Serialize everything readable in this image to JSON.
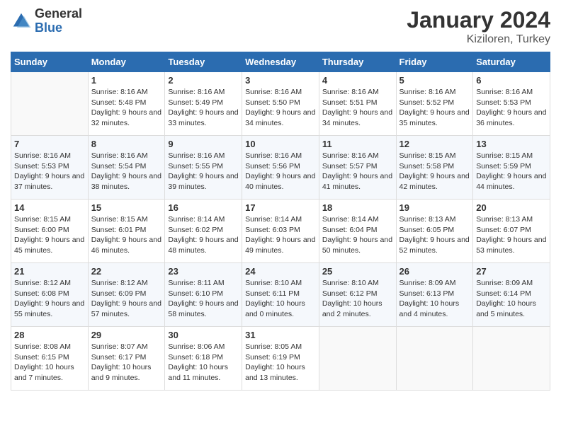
{
  "header": {
    "logo": {
      "general": "General",
      "blue": "Blue"
    },
    "title": "January 2024",
    "subtitle": "Kiziloren, Turkey"
  },
  "calendar": {
    "weekdays": [
      "Sunday",
      "Monday",
      "Tuesday",
      "Wednesday",
      "Thursday",
      "Friday",
      "Saturday"
    ],
    "weeks": [
      [
        {
          "day": "",
          "sunrise": "",
          "sunset": "",
          "daylight": ""
        },
        {
          "day": "1",
          "sunrise": "Sunrise: 8:16 AM",
          "sunset": "Sunset: 5:48 PM",
          "daylight": "Daylight: 9 hours and 32 minutes."
        },
        {
          "day": "2",
          "sunrise": "Sunrise: 8:16 AM",
          "sunset": "Sunset: 5:49 PM",
          "daylight": "Daylight: 9 hours and 33 minutes."
        },
        {
          "day": "3",
          "sunrise": "Sunrise: 8:16 AM",
          "sunset": "Sunset: 5:50 PM",
          "daylight": "Daylight: 9 hours and 34 minutes."
        },
        {
          "day": "4",
          "sunrise": "Sunrise: 8:16 AM",
          "sunset": "Sunset: 5:51 PM",
          "daylight": "Daylight: 9 hours and 34 minutes."
        },
        {
          "day": "5",
          "sunrise": "Sunrise: 8:16 AM",
          "sunset": "Sunset: 5:52 PM",
          "daylight": "Daylight: 9 hours and 35 minutes."
        },
        {
          "day": "6",
          "sunrise": "Sunrise: 8:16 AM",
          "sunset": "Sunset: 5:53 PM",
          "daylight": "Daylight: 9 hours and 36 minutes."
        }
      ],
      [
        {
          "day": "7",
          "sunrise": "Sunrise: 8:16 AM",
          "sunset": "Sunset: 5:53 PM",
          "daylight": "Daylight: 9 hours and 37 minutes."
        },
        {
          "day": "8",
          "sunrise": "Sunrise: 8:16 AM",
          "sunset": "Sunset: 5:54 PM",
          "daylight": "Daylight: 9 hours and 38 minutes."
        },
        {
          "day": "9",
          "sunrise": "Sunrise: 8:16 AM",
          "sunset": "Sunset: 5:55 PM",
          "daylight": "Daylight: 9 hours and 39 minutes."
        },
        {
          "day": "10",
          "sunrise": "Sunrise: 8:16 AM",
          "sunset": "Sunset: 5:56 PM",
          "daylight": "Daylight: 9 hours and 40 minutes."
        },
        {
          "day": "11",
          "sunrise": "Sunrise: 8:16 AM",
          "sunset": "Sunset: 5:57 PM",
          "daylight": "Daylight: 9 hours and 41 minutes."
        },
        {
          "day": "12",
          "sunrise": "Sunrise: 8:15 AM",
          "sunset": "Sunset: 5:58 PM",
          "daylight": "Daylight: 9 hours and 42 minutes."
        },
        {
          "day": "13",
          "sunrise": "Sunrise: 8:15 AM",
          "sunset": "Sunset: 5:59 PM",
          "daylight": "Daylight: 9 hours and 44 minutes."
        }
      ],
      [
        {
          "day": "14",
          "sunrise": "Sunrise: 8:15 AM",
          "sunset": "Sunset: 6:00 PM",
          "daylight": "Daylight: 9 hours and 45 minutes."
        },
        {
          "day": "15",
          "sunrise": "Sunrise: 8:15 AM",
          "sunset": "Sunset: 6:01 PM",
          "daylight": "Daylight: 9 hours and 46 minutes."
        },
        {
          "day": "16",
          "sunrise": "Sunrise: 8:14 AM",
          "sunset": "Sunset: 6:02 PM",
          "daylight": "Daylight: 9 hours and 48 minutes."
        },
        {
          "day": "17",
          "sunrise": "Sunrise: 8:14 AM",
          "sunset": "Sunset: 6:03 PM",
          "daylight": "Daylight: 9 hours and 49 minutes."
        },
        {
          "day": "18",
          "sunrise": "Sunrise: 8:14 AM",
          "sunset": "Sunset: 6:04 PM",
          "daylight": "Daylight: 9 hours and 50 minutes."
        },
        {
          "day": "19",
          "sunrise": "Sunrise: 8:13 AM",
          "sunset": "Sunset: 6:05 PM",
          "daylight": "Daylight: 9 hours and 52 minutes."
        },
        {
          "day": "20",
          "sunrise": "Sunrise: 8:13 AM",
          "sunset": "Sunset: 6:07 PM",
          "daylight": "Daylight: 9 hours and 53 minutes."
        }
      ],
      [
        {
          "day": "21",
          "sunrise": "Sunrise: 8:12 AM",
          "sunset": "Sunset: 6:08 PM",
          "daylight": "Daylight: 9 hours and 55 minutes."
        },
        {
          "day": "22",
          "sunrise": "Sunrise: 8:12 AM",
          "sunset": "Sunset: 6:09 PM",
          "daylight": "Daylight: 9 hours and 57 minutes."
        },
        {
          "day": "23",
          "sunrise": "Sunrise: 8:11 AM",
          "sunset": "Sunset: 6:10 PM",
          "daylight": "Daylight: 9 hours and 58 minutes."
        },
        {
          "day": "24",
          "sunrise": "Sunrise: 8:10 AM",
          "sunset": "Sunset: 6:11 PM",
          "daylight": "Daylight: 10 hours and 0 minutes."
        },
        {
          "day": "25",
          "sunrise": "Sunrise: 8:10 AM",
          "sunset": "Sunset: 6:12 PM",
          "daylight": "Daylight: 10 hours and 2 minutes."
        },
        {
          "day": "26",
          "sunrise": "Sunrise: 8:09 AM",
          "sunset": "Sunset: 6:13 PM",
          "daylight": "Daylight: 10 hours and 4 minutes."
        },
        {
          "day": "27",
          "sunrise": "Sunrise: 8:09 AM",
          "sunset": "Sunset: 6:14 PM",
          "daylight": "Daylight: 10 hours and 5 minutes."
        }
      ],
      [
        {
          "day": "28",
          "sunrise": "Sunrise: 8:08 AM",
          "sunset": "Sunset: 6:15 PM",
          "daylight": "Daylight: 10 hours and 7 minutes."
        },
        {
          "day": "29",
          "sunrise": "Sunrise: 8:07 AM",
          "sunset": "Sunset: 6:17 PM",
          "daylight": "Daylight: 10 hours and 9 minutes."
        },
        {
          "day": "30",
          "sunrise": "Sunrise: 8:06 AM",
          "sunset": "Sunset: 6:18 PM",
          "daylight": "Daylight: 10 hours and 11 minutes."
        },
        {
          "day": "31",
          "sunrise": "Sunrise: 8:05 AM",
          "sunset": "Sunset: 6:19 PM",
          "daylight": "Daylight: 10 hours and 13 minutes."
        },
        {
          "day": "",
          "sunrise": "",
          "sunset": "",
          "daylight": ""
        },
        {
          "day": "",
          "sunrise": "",
          "sunset": "",
          "daylight": ""
        },
        {
          "day": "",
          "sunrise": "",
          "sunset": "",
          "daylight": ""
        }
      ]
    ]
  }
}
